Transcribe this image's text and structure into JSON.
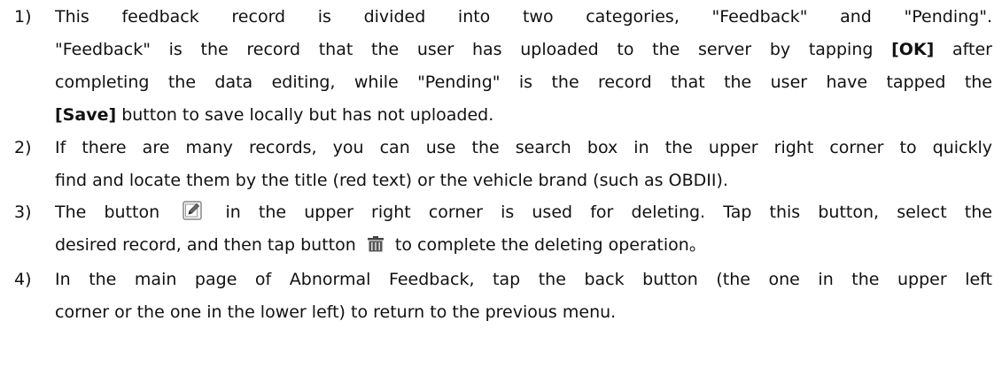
{
  "items": [
    {
      "num": "1)",
      "l1": "This feedback record is divided into two categories, \"Feedback\" and \"Pending\".",
      "l2a": "\"Feedback\" is the record that the user has uploaded to the server by tapping ",
      "l2b": "[OK]",
      "l2c": " after",
      "l3": "completing the data editing, while \"Pending\" is the record that the user have tapped the",
      "l4a": "[Save]",
      "l4b": " button to save locally but has not uploaded."
    },
    {
      "num": "2)",
      "l1": "If there are many records, you can use the search box in the upper right corner to quickly",
      "l2": "find and locate them by the title (red text) or the vehicle brand (such as OBDII)."
    },
    {
      "num": "3)",
      "l1a": "The button ",
      "l1b": " in the upper right corner is used for deleting. Tap this button, select the",
      "l2a": "desired record, and then tap button ",
      "l2b": " to complete the deleting operation。"
    },
    {
      "num": "4)",
      "l1": "In the main page of Abnormal Feedback, tap the back button (the one in the upper left",
      "l2": "corner or the one in the lower left) to return to the previous menu."
    }
  ],
  "icons": {
    "edit": "edit-icon",
    "delete": "trash-icon"
  }
}
